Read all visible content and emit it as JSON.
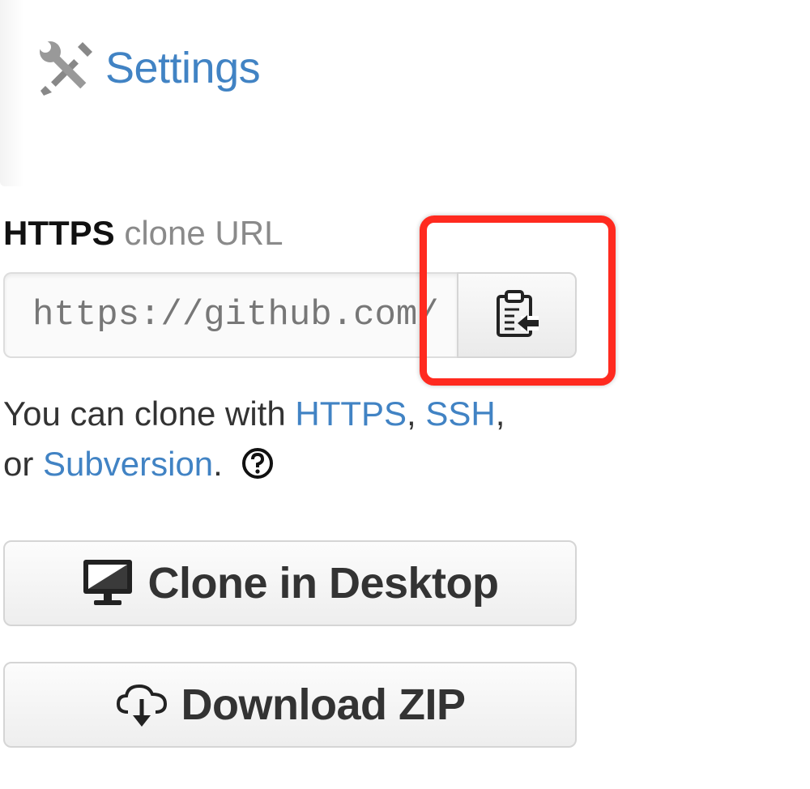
{
  "settings": {
    "label": "Settings",
    "icon": "tools-icon",
    "color": "#4183c4"
  },
  "clone_url": {
    "protocol": "HTTPS",
    "heading_rest": "clone URL",
    "value": "https://github.com/",
    "copy_icon": "clipboard-icon"
  },
  "help": {
    "prefix": "You can clone with",
    "link_https": "HTTPS",
    "sep1": ",",
    "link_ssh": "SSH",
    "sep2": ",",
    "or_text": "or",
    "link_subversion": "Subversion",
    "period": ".",
    "help_icon": "question-circle-icon"
  },
  "buttons": {
    "clone_desktop": "Clone in Desktop",
    "download_zip": "Download ZIP",
    "desktop_icon": "monitor-icon",
    "zip_icon": "cloud-download-icon"
  },
  "colors": {
    "link": "#4183c4",
    "highlight": "#ff2a1f"
  }
}
